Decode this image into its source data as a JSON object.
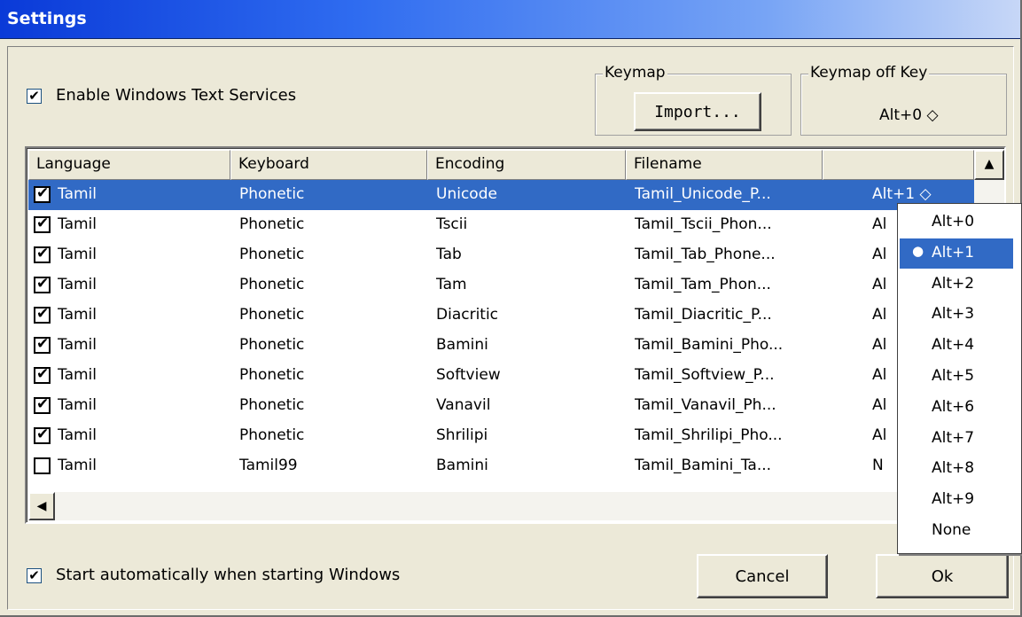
{
  "window": {
    "title": "Settings"
  },
  "options": {
    "enable_text_services": {
      "label": "Enable Windows Text Services",
      "checked": true
    },
    "start_automatically": {
      "label": "Start automatically when starting Windows",
      "checked": true
    }
  },
  "keymap_group": {
    "legend": "Keymap",
    "import_label": "Import..."
  },
  "keymap_off_group": {
    "legend": "Keymap off Key",
    "value": "Alt+0 ◇"
  },
  "table": {
    "columns": [
      "Language",
      "Keyboard",
      "Encoding",
      "Filename",
      ""
    ],
    "rows": [
      {
        "checked": true,
        "language": "Tamil",
        "keyboard": "Phonetic",
        "encoding": "Unicode",
        "filename": "Tamil_Unicode_P...",
        "key": "Alt+1 ◇"
      },
      {
        "checked": true,
        "language": "Tamil",
        "keyboard": "Phonetic",
        "encoding": "Tscii",
        "filename": "Tamil_Tscii_Phon...",
        "key": "Al"
      },
      {
        "checked": true,
        "language": "Tamil",
        "keyboard": "Phonetic",
        "encoding": "Tab",
        "filename": "Tamil_Tab_Phone...",
        "key": "Al"
      },
      {
        "checked": true,
        "language": "Tamil",
        "keyboard": "Phonetic",
        "encoding": "Tam",
        "filename": "Tamil_Tam_Phon...",
        "key": "Al"
      },
      {
        "checked": true,
        "language": "Tamil",
        "keyboard": "Phonetic",
        "encoding": "Diacritic",
        "filename": "Tamil_Diacritic_P...",
        "key": "Al"
      },
      {
        "checked": true,
        "language": "Tamil",
        "keyboard": "Phonetic",
        "encoding": "Bamini",
        "filename": "Tamil_Bamini_Pho...",
        "key": "Al"
      },
      {
        "checked": true,
        "language": "Tamil",
        "keyboard": "Phonetic",
        "encoding": "Softview",
        "filename": "Tamil_Softview_P...",
        "key": "Al"
      },
      {
        "checked": true,
        "language": "Tamil",
        "keyboard": "Phonetic",
        "encoding": "Vanavil",
        "filename": "Tamil_Vanavil_Ph...",
        "key": "Al"
      },
      {
        "checked": true,
        "language": "Tamil",
        "keyboard": "Phonetic",
        "encoding": "Shrilipi",
        "filename": "Tamil_Shrilipi_Pho...",
        "key": "Al"
      },
      {
        "checked": false,
        "language": "Tamil",
        "keyboard": "Tamil99",
        "encoding": "Bamini",
        "filename": "Tamil_Bamini_Ta...",
        "key": "N"
      }
    ],
    "selected_row": 0
  },
  "dropdown": {
    "options": [
      "Alt+0",
      "Alt+1",
      "Alt+2",
      "Alt+3",
      "Alt+4",
      "Alt+5",
      "Alt+6",
      "Alt+7",
      "Alt+8",
      "Alt+9",
      "None"
    ],
    "selected": "Alt+1"
  },
  "buttons": {
    "cancel": "Cancel",
    "ok": "Ok"
  },
  "icons": {
    "scroll_up": "▲",
    "scroll_left": "◀",
    "check": "✔",
    "selected_dot": "●"
  },
  "colors": {
    "selection": "#316ac5",
    "title_start": "#0a3ad8",
    "face": "#ece9d8"
  }
}
